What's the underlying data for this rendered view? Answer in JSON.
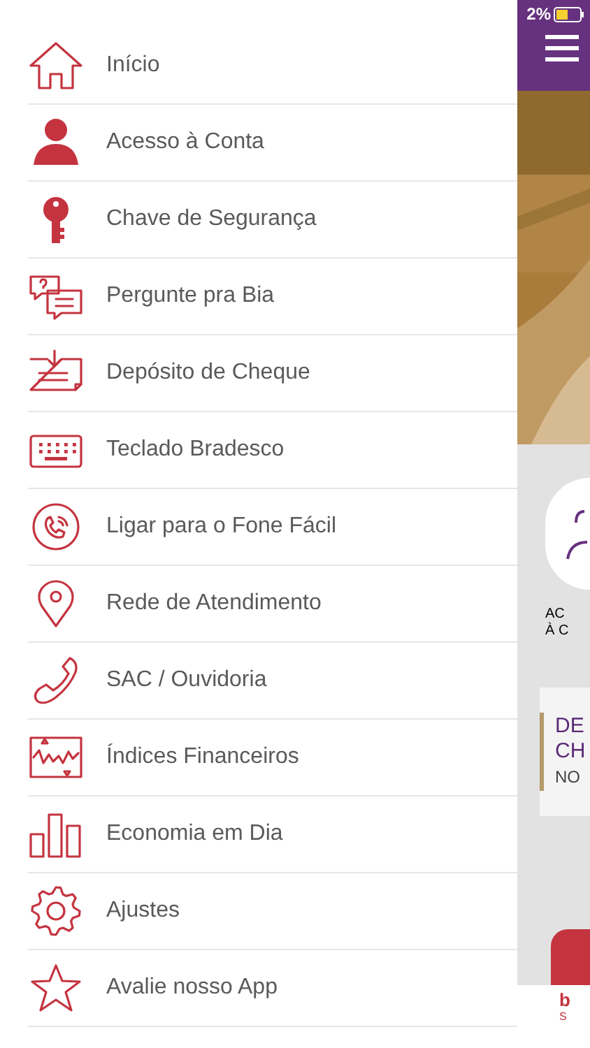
{
  "menu": {
    "items": [
      {
        "label": "Início",
        "kind": "home"
      },
      {
        "label": "Acesso à Conta",
        "kind": "person"
      },
      {
        "label": "Chave de Segurança",
        "kind": "key"
      },
      {
        "label": "Pergunte pra Bia",
        "kind": "chat"
      },
      {
        "label": "Depósito de Cheque",
        "kind": "cheque"
      },
      {
        "label": "Teclado Bradesco",
        "kind": "keyboard"
      },
      {
        "label": "Ligar para o Fone Fácil",
        "kind": "phonecircle"
      },
      {
        "label": "Rede de Atendimento",
        "kind": "pin"
      },
      {
        "label": "SAC / Ouvidoria",
        "kind": "phone"
      },
      {
        "label": "Índices Financeiros",
        "kind": "indices"
      },
      {
        "label": "Economia em Dia",
        "kind": "bars"
      },
      {
        "label": "Ajustes",
        "kind": "gear"
      },
      {
        "label": "Avalie nosso App",
        "kind": "star"
      }
    ]
  },
  "behind": {
    "status_battery": "2%",
    "account_label": [
      "AC",
      "À C"
    ],
    "card": {
      "title": [
        "DE",
        "CH"
      ],
      "subtitle": "NO"
    },
    "footer_logo": [
      "b",
      "S"
    ]
  }
}
